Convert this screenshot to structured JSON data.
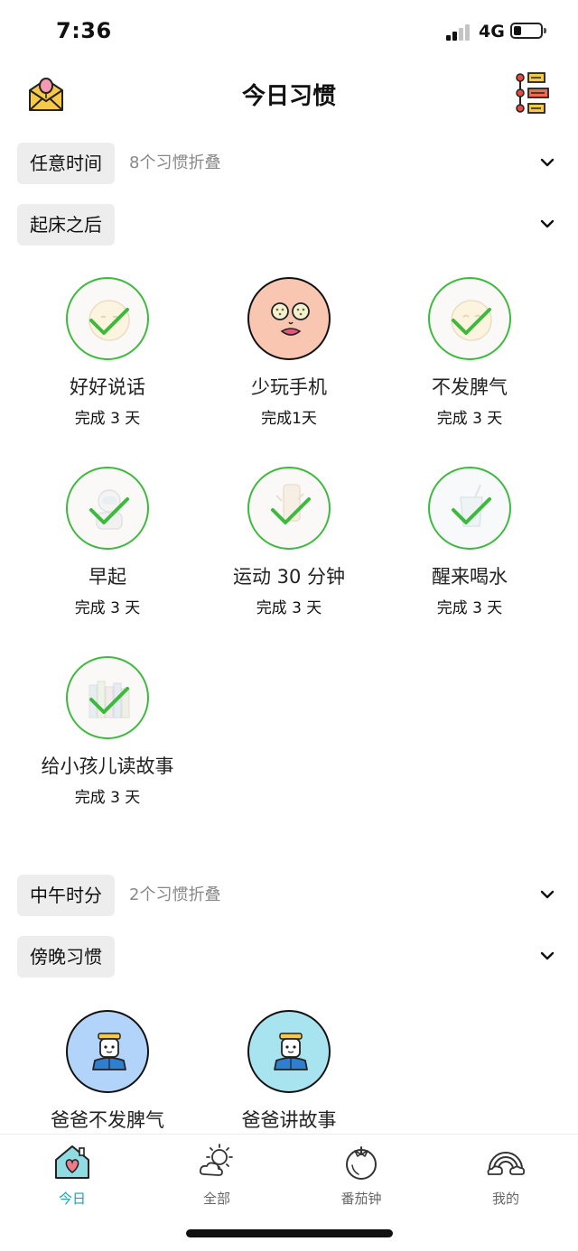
{
  "status": {
    "time": "7:36",
    "network": "4G"
  },
  "header": {
    "title": "今日习惯",
    "left_icon": "letter-balloon-icon",
    "right_icon": "list-tree-icon"
  },
  "groups": [
    {
      "name": "任意时间",
      "note": "8个习惯折叠"
    },
    {
      "name": "起床之后",
      "note": ""
    },
    {
      "name": "中午时分",
      "note": "2个习惯折叠"
    },
    {
      "name": "傍晚习惯",
      "note": ""
    }
  ],
  "habits_morning": [
    {
      "name": "好好说话",
      "status": "完成 3 天",
      "done": true,
      "icon": "smile-face-icon"
    },
    {
      "name": "少玩手机",
      "status": "完成1天",
      "done": false,
      "icon": "cucumber-mask-face-icon",
      "color": "#f9c7b1"
    },
    {
      "name": "不发脾气",
      "status": "完成 3 天",
      "done": true,
      "icon": "calm-face-icon"
    },
    {
      "name": "早起",
      "status": "完成 3 天",
      "done": true,
      "icon": "astronaut-icon"
    },
    {
      "name": "运动 30 分钟",
      "status": "完成 3 天",
      "done": true,
      "icon": "running-shoes-icon"
    },
    {
      "name": "醒来喝水",
      "status": "完成 3 天",
      "done": true,
      "icon": "water-cup-icon"
    },
    {
      "name": "给小孩儿读故事",
      "status": "完成 3 天",
      "done": true,
      "icon": "books-icon"
    }
  ],
  "habits_evening": [
    {
      "name": "爸爸不发脾气",
      "icon": "dad-icon",
      "color": "#b3d4fa"
    },
    {
      "name": "爸爸讲故事",
      "icon": "dad-icon",
      "color": "#a8e4ef"
    }
  ],
  "tabs": [
    {
      "label": "今日",
      "icon": "home-heart-icon",
      "active": true
    },
    {
      "label": "全部",
      "icon": "sun-cloud-icon",
      "active": false
    },
    {
      "label": "番茄钟",
      "icon": "tomato-icon",
      "active": false
    },
    {
      "label": "我的",
      "icon": "rainbow-icon",
      "active": false
    }
  ],
  "colors": {
    "accent": "#1aa3b6",
    "check": "#3dba3d"
  }
}
